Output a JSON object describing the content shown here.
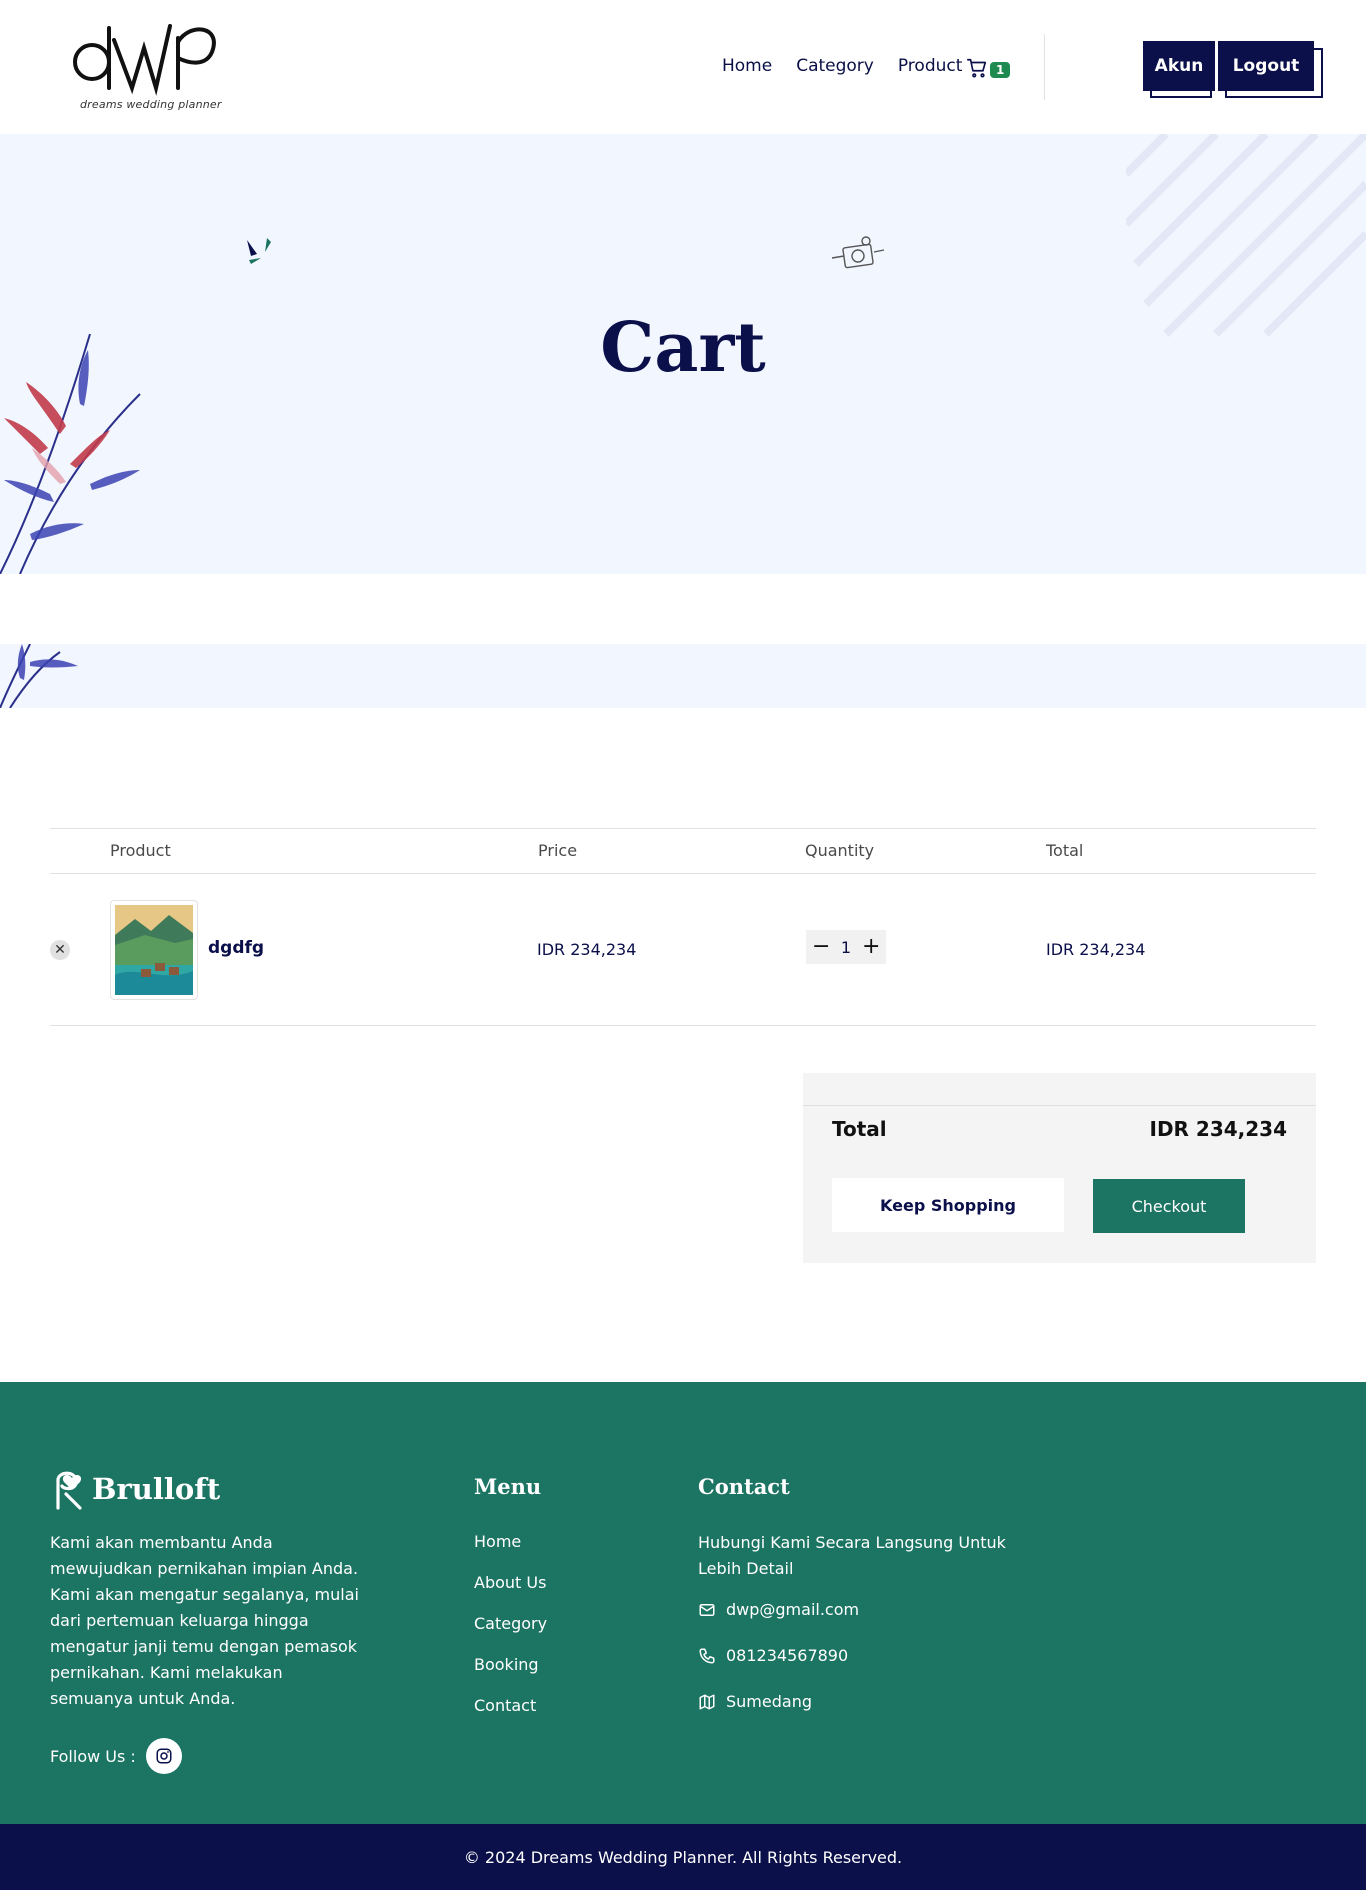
{
  "header": {
    "logo_text": "dwp",
    "logo_tagline": "dreams wedding planner",
    "nav": {
      "home": "Home",
      "category": "Category",
      "product": "Product"
    },
    "cart_count": "1",
    "account_label": "Akun",
    "logout_label": "Logout"
  },
  "hero": {
    "title": "Cart"
  },
  "cart": {
    "columns": {
      "product": "Product",
      "price": "Price",
      "quantity": "Quantity",
      "total": "Total"
    },
    "items": [
      {
        "name": "dgdfg",
        "price": "IDR 234,234",
        "quantity": "1",
        "total": "IDR 234,234"
      }
    ]
  },
  "summary": {
    "label": "Total",
    "value": "IDR 234,234",
    "keep_shopping": "Keep Shopping",
    "checkout": "Checkout"
  },
  "footer": {
    "brand": "Brulloft",
    "about": "Kami akan membantu Anda mewujudkan pernikahan impian Anda. Kami akan mengatur segalanya, mulai dari pertemuan keluarga hingga mengatur janji temu dengan pemasok pernikahan. Kami melakukan semuanya untuk Anda.",
    "follow_label": "Follow Us :",
    "menu_heading": "Menu",
    "menu": [
      "Home",
      "About Us",
      "Category",
      "Booking",
      "Contact"
    ],
    "contact_heading": "Contact",
    "contact_intro": "Hubungi Kami Secara Langsung Untuk Lebih Detail",
    "email": "dwp@gmail.com",
    "phone": "081234567890",
    "location": "Sumedang",
    "copyright": "© 2024 Dreams Wedding Planner. All Rights Reserved."
  },
  "colors": {
    "navy": "#0b0f4a",
    "teal": "#1c7463",
    "hero_bg": "#f2f6ff",
    "badge_green": "#1f8a4f"
  }
}
